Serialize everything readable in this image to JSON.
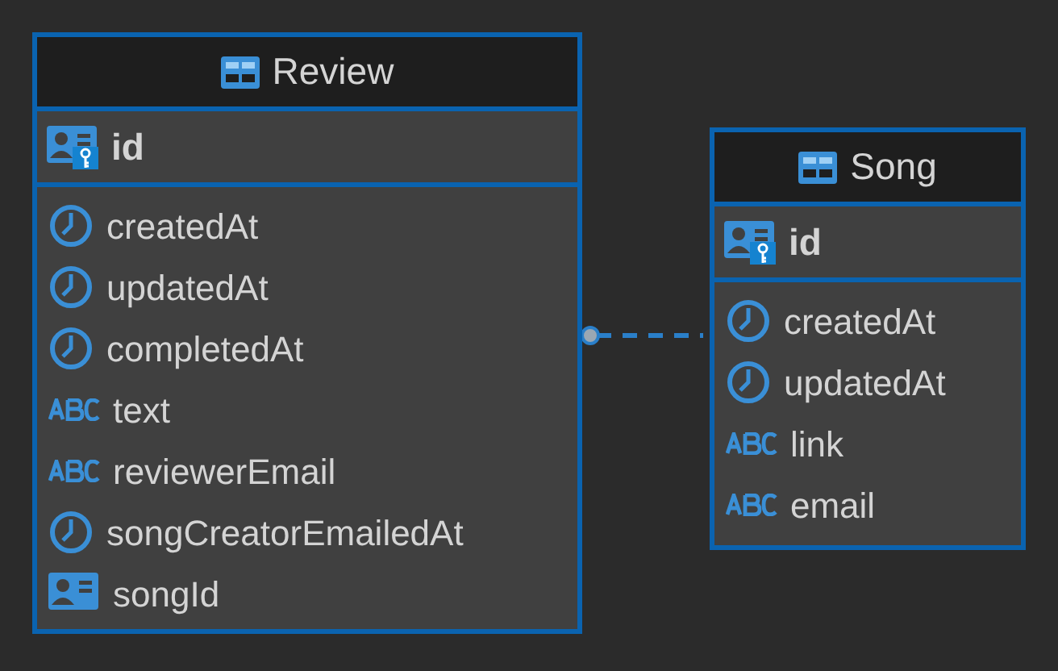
{
  "tables": [
    {
      "name": "Review",
      "key_field": {
        "name": "id",
        "kind": "primary_key"
      },
      "fields": [
        {
          "name": "createdAt",
          "kind": "datetime"
        },
        {
          "name": "updatedAt",
          "kind": "datetime"
        },
        {
          "name": "completedAt",
          "kind": "datetime"
        },
        {
          "name": "text",
          "kind": "string"
        },
        {
          "name": "reviewerEmail",
          "kind": "string"
        },
        {
          "name": "songCreatorEmailedAt",
          "kind": "datetime"
        },
        {
          "name": "songId",
          "kind": "reference"
        }
      ]
    },
    {
      "name": "Song",
      "key_field": {
        "name": "id",
        "kind": "primary_key"
      },
      "fields": [
        {
          "name": "createdAt",
          "kind": "datetime"
        },
        {
          "name": "updatedAt",
          "kind": "datetime"
        },
        {
          "name": "link",
          "kind": "string"
        },
        {
          "name": "email",
          "kind": "string"
        }
      ]
    }
  ]
}
